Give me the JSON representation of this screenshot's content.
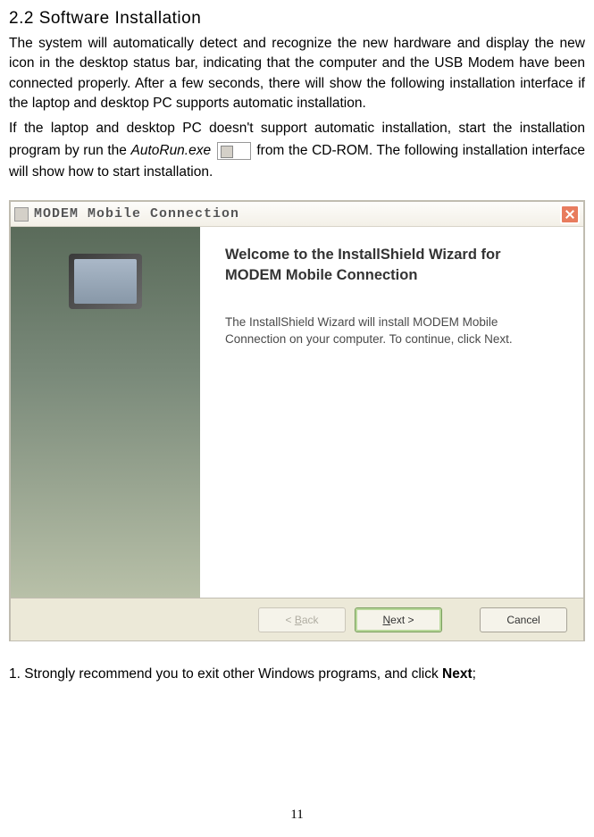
{
  "heading": "2.2 Software Installation",
  "para1": "The system will automatically detect and recognize the new hardware and display the new icon in the desktop status bar, indicating that the computer and the USB Modem have been connected properly. After a few seconds, there will show the following installation interface if the laptop and desktop PC supports automatic installation.",
  "para2_a": "If the laptop and desktop PC doesn't support automatic installation, start the installation program by run the ",
  "para2_italic": "AutoRun.exe",
  "para2_b": "  from the CD-ROM. The following installation interface will show how to start installation.",
  "installer": {
    "title": "MODEM Mobile Connection",
    "welcome_title": "Welcome to the InstallShield Wizard for MODEM Mobile Connection",
    "welcome_text": "The InstallShield Wizard will install MODEM Mobile Connection on your computer.  To continue, click Next.",
    "back_prefix": "< ",
    "back_under": "B",
    "back_suffix": "ack",
    "next_under": "N",
    "next_suffix": "ext >",
    "cancel": "Cancel"
  },
  "footer_a": "1. Strongly recommend you to exit other Windows programs, and click ",
  "footer_bold": "Next",
  "footer_b": ";",
  "page_number": "11"
}
